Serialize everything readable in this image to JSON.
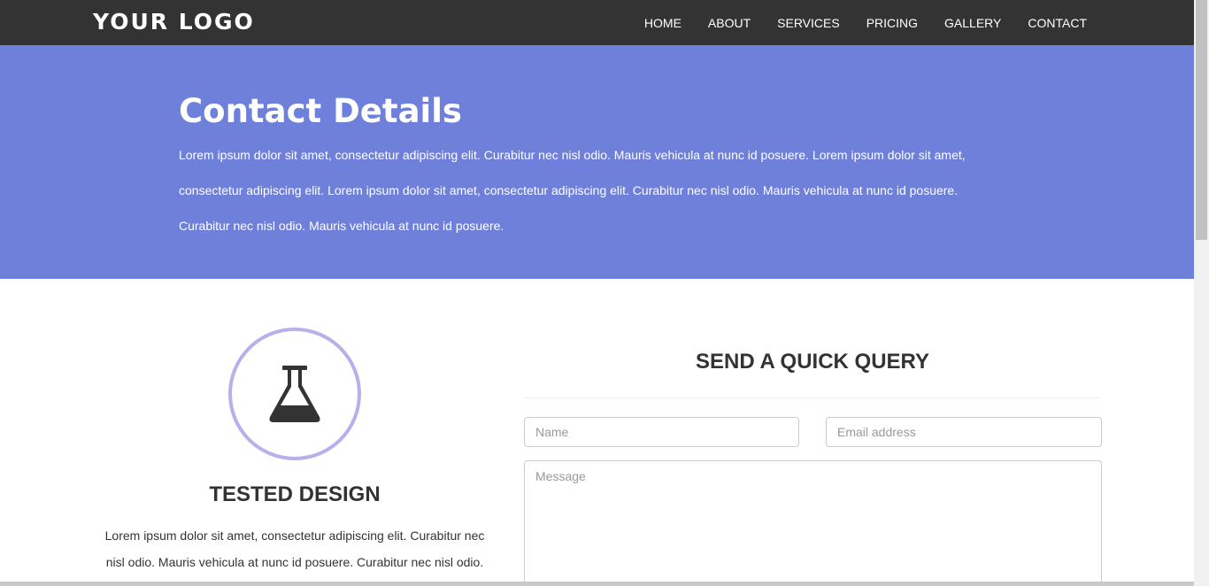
{
  "header": {
    "logo": "YOUR LOGO",
    "nav": [
      "HOME",
      "ABOUT",
      "SERVICES",
      "PRICING",
      "GALLERY",
      "CONTACT"
    ]
  },
  "banner": {
    "title": "Contact Details",
    "text": "Lorem ipsum dolor sit amet, consectetur adipiscing elit. Curabitur nec nisl odio. Mauris vehicula at nunc id posuere. Lorem ipsum dolor sit amet, consectetur adipiscing elit. Lorem ipsum dolor sit amet, consectetur adipiscing elit. Curabitur nec nisl odio. Mauris vehicula at nunc id posuere. Curabitur nec nisl odio. Mauris vehicula at nunc id posuere."
  },
  "feature": {
    "icon": "flask-icon",
    "title": "TESTED DESIGN",
    "text": "Lorem ipsum dolor sit amet, consectetur adipiscing elit. Curabitur nec nisl odio. Mauris vehicula at nunc id posuere. Curabitur nec nisl odio. Mauris vehicula at nunc id posuere."
  },
  "query_form": {
    "title": "SEND A QUICK QUERY",
    "name_placeholder": "Name",
    "email_placeholder": "Email address",
    "message_placeholder": "Message"
  },
  "colors": {
    "navbar": "#333333",
    "banner": "#6f80db",
    "circle_border": "#b7b0ea"
  }
}
